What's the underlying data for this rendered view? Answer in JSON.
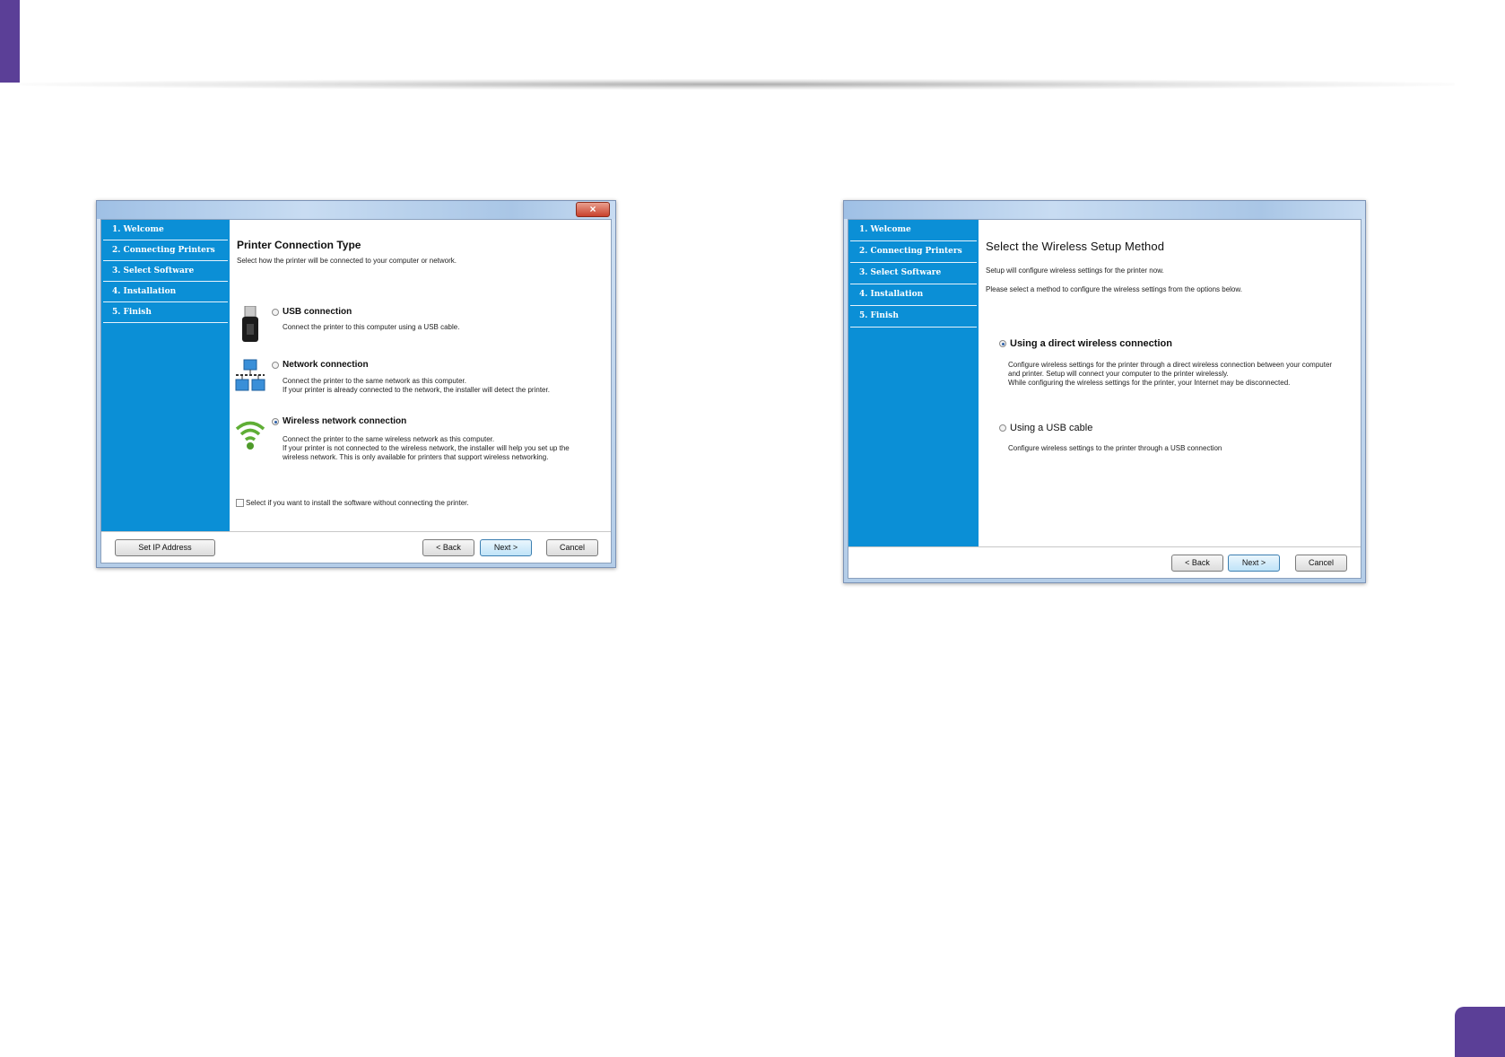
{
  "left_dialog": {
    "close_glyph": "×",
    "sidebar": [
      "1. Welcome",
      "2. Connecting Printers",
      "3. Select Software",
      "4. Installation",
      "5. Finish"
    ],
    "title": "Printer Connection Type",
    "subtitle": "Select how the printer will be connected to your computer or network.",
    "options": [
      {
        "label": "USB connection",
        "selected": false,
        "icon": "usb-icon",
        "desc": [
          "Connect the printer to this computer using a USB cable."
        ]
      },
      {
        "label": "Network connection",
        "selected": false,
        "icon": "network-icon",
        "desc": [
          "Connect the printer to the same network as this computer.",
          "If your printer is already connected to the network, the installer will detect the printer."
        ]
      },
      {
        "label": "Wireless network connection",
        "selected": true,
        "icon": "wifi-icon",
        "desc": [
          "Connect the printer to the same wireless network as this computer.",
          "If your printer is not connected to the wireless network, the installer will help you set up the",
          "wireless network. This is only available for printers that support wireless networking."
        ]
      }
    ],
    "checkbox_label": "Select if you want to install the software without connecting the printer.",
    "buttons": {
      "set_ip": "Set IP Address",
      "back": "< Back",
      "next": "Next >",
      "cancel": "Cancel"
    }
  },
  "right_dialog": {
    "sidebar": [
      "1. Welcome",
      "2. Connecting Printers",
      "3. Select Software",
      "4. Installation",
      "5. Finish"
    ],
    "title": "Select the Wireless Setup Method",
    "line1": "Setup will configure wireless settings for the printer now.",
    "line2": "Please select a method to configure the wireless settings from the options below.",
    "options": [
      {
        "label": "Using a direct wireless connection",
        "selected": true,
        "desc": [
          "Configure wireless settings for the printer through a direct wireless connection between your computer",
          "and printer. Setup will connect your computer to the printer wirelessly.",
          "While configuring the wireless settings for the printer, your Internet may be disconnected."
        ]
      },
      {
        "label": "Using a USB cable",
        "selected": false,
        "desc": [
          "Configure wireless settings to the printer through a USB connection"
        ]
      }
    ],
    "buttons": {
      "back": "< Back",
      "next": "Next >",
      "cancel": "Cancel"
    }
  },
  "colors": {
    "accent_purple": "#5b3f97",
    "sidebar_blue": "#0b8fd6"
  }
}
